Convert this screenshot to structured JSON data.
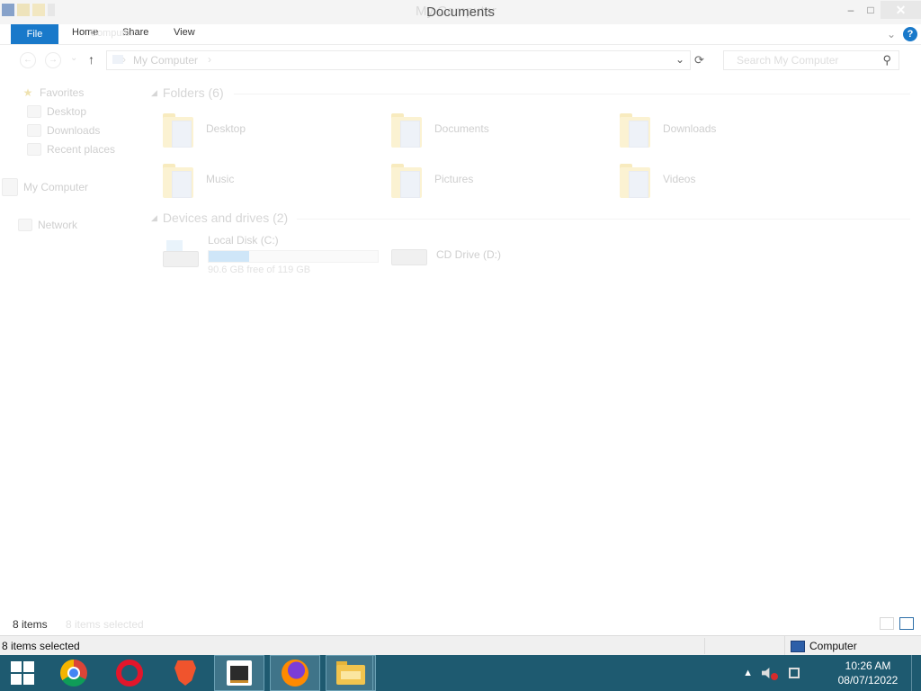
{
  "window": {
    "title": "Documents",
    "ghost_title": "My Computer",
    "controls": {
      "minimize": "–",
      "maximize": "□",
      "close": "✕"
    }
  },
  "ribbon": {
    "file": "File",
    "home": "Home",
    "share": "Share",
    "view": "View",
    "ghost_home": "Computer",
    "expand": "⌄",
    "help": "?"
  },
  "address": {
    "back": "←",
    "forward": "→",
    "recent": "⌄",
    "up": "↑",
    "path": "My Computer",
    "path_chevron": "›",
    "dropdown": "⌄",
    "refresh": "⟳",
    "search_placeholder": "Search My Computer",
    "search_icon": "⚲"
  },
  "nav": {
    "favorites": "Favorites",
    "desktop": "Desktop",
    "downloads": "Downloads",
    "recent_places": "Recent places",
    "my_computer": "My Computer",
    "network": "Network"
  },
  "folders": {
    "header": "Folders (6)",
    "items": [
      "Desktop",
      "Documents",
      "Downloads",
      "Music",
      "Pictures",
      "Videos"
    ]
  },
  "drives": {
    "header": "Devices and drives (2)",
    "local": {
      "name": "Local Disk (C:)",
      "free": "90.6 GB free of 119 GB",
      "used_fraction": 0.24
    },
    "cd": {
      "name": "CD Drive (D:)"
    }
  },
  "status": {
    "count": "8 items",
    "count_ghost": "8 items selected",
    "selected": "8 items selected",
    "zone": "Computer"
  },
  "taskbar": {
    "clock_time": "10:26 AM",
    "clock_date": "08/07/12022",
    "tray_up": "▲"
  },
  "colors": {
    "accent": "#1979ca",
    "taskbar": "#1e5a70"
  }
}
